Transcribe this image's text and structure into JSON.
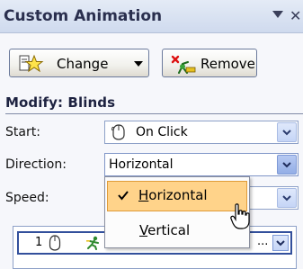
{
  "titlebar": {
    "title": "Custom Animation",
    "menu_icon": "chevron-down-icon",
    "close_icon": "close-icon"
  },
  "toolbar": {
    "change_label": "Change",
    "change_icon": "star-icon",
    "remove_label": "Remove",
    "remove_icon": "remove-effect-icon"
  },
  "section": {
    "title": "Modify: Blinds"
  },
  "fields": {
    "start_label": "Start:",
    "start_value": "On Click",
    "direction_label": "Direction:",
    "direction_value": "Horizontal",
    "speed_label": "Speed:"
  },
  "dropdown": {
    "options": [
      {
        "mnemonic": "H",
        "rest": "orizontal",
        "selected": true
      },
      {
        "mnemonic": "V",
        "rest": "ertical",
        "selected": false
      }
    ]
  },
  "effect_list": {
    "items": [
      {
        "order": "1",
        "trigger_icon": "mouse-icon",
        "effect_icon": "running-figure-icon",
        "truncated": "..."
      }
    ]
  },
  "colors": {
    "title_bg": "#d6e0f2",
    "highlight": "#ffd38a",
    "highlight_border": "#e09b38",
    "combo_button": "#c5d5f6",
    "selection_border": "#33509c"
  }
}
